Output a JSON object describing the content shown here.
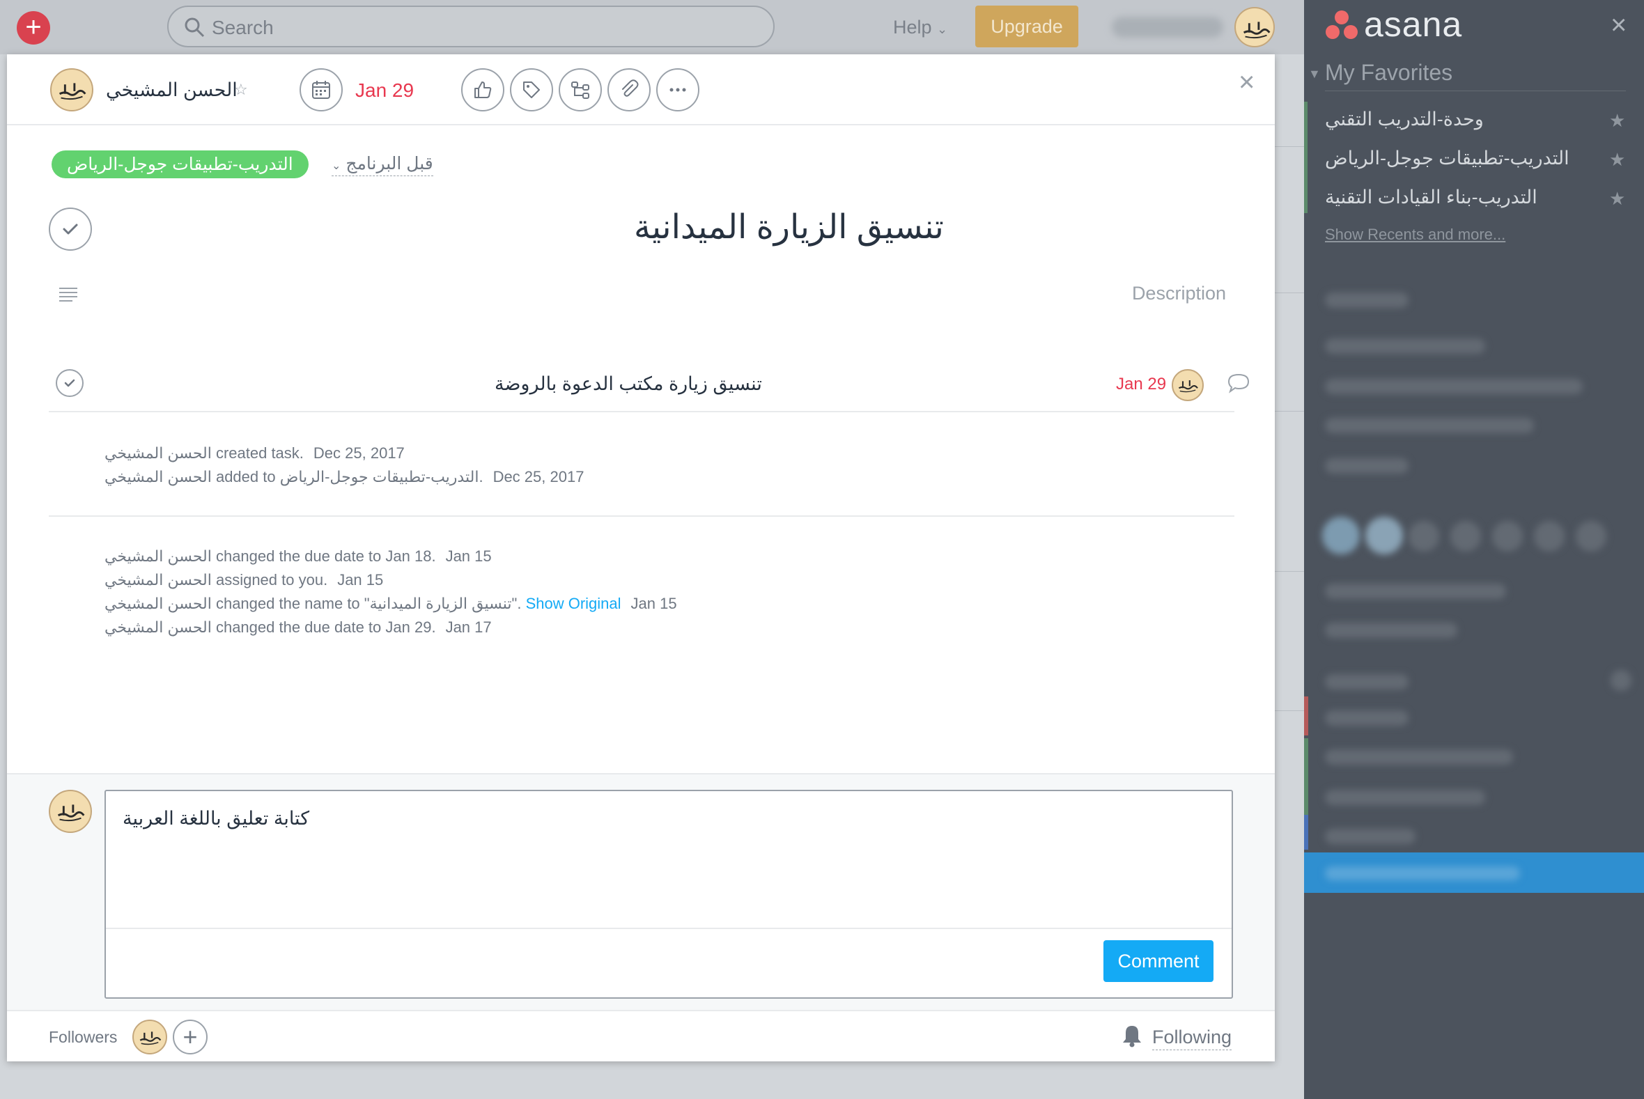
{
  "topbar": {
    "search_placeholder": "Search",
    "help_label": "Help",
    "upgrade_label": "Upgrade"
  },
  "sidebar": {
    "logo_text": "asana",
    "favorites_header": "My Favorites",
    "favorites": [
      {
        "label": "وحدة-التدريب التقني"
      },
      {
        "label": "التدريب-تطبيقات جوجل-الرياض"
      },
      {
        "label": "التدريب-بناء القيادات التقنية"
      }
    ],
    "show_recents": "Show Recents and more..."
  },
  "task": {
    "assignee_name": "الحسن المشيخي",
    "due_date": "Jan 29",
    "project_tag": "التدريب-تطبيقات جوجل-الرياض",
    "section": "قبل البرنامج",
    "title": "تنسيق الزيارة الميدانية",
    "description_placeholder": "Description",
    "subtask": {
      "name": "تنسيق زيارة مكتب الدعوة بالروضة",
      "due": "Jan 29"
    }
  },
  "stories": {
    "group1": [
      {
        "actor": "الحسن المشيخي",
        "action": " created task.",
        "date": "Dec 25, 2017"
      },
      {
        "actor": "الحسن المشيخي",
        "action": " added to ",
        "target": "التدريب-تطبيقات جوجل-الرياض",
        "suffix": ".",
        "date": "Dec 25, 2017"
      }
    ],
    "group2": [
      {
        "actor": "الحسن المشيخي",
        "action": " changed the due date to Jan 18.",
        "date": "Jan 15"
      },
      {
        "actor": "الحسن المشيخي",
        "action": " assigned to you.",
        "date": "Jan 15"
      },
      {
        "actor": "الحسن المشيخي",
        "action": " changed the name to \"",
        "target": "تنسيق الزيارة الميدانية",
        "suffix": "\".",
        "link": "Show Original",
        "date": "Jan 15"
      },
      {
        "actor": "الحسن المشيخي",
        "action": " changed the due date to Jan 29.",
        "date": "Jan 17"
      }
    ]
  },
  "composer": {
    "text": "كتابة تعليق باللغة العربية",
    "comment_button": "Comment"
  },
  "footer": {
    "followers_label": "Followers",
    "following_label": "Following"
  },
  "colors": {
    "accent": "#14aaf5",
    "due_red": "#e8384f",
    "project_green": "#62d26f",
    "upgrade": "#cfa65c"
  }
}
